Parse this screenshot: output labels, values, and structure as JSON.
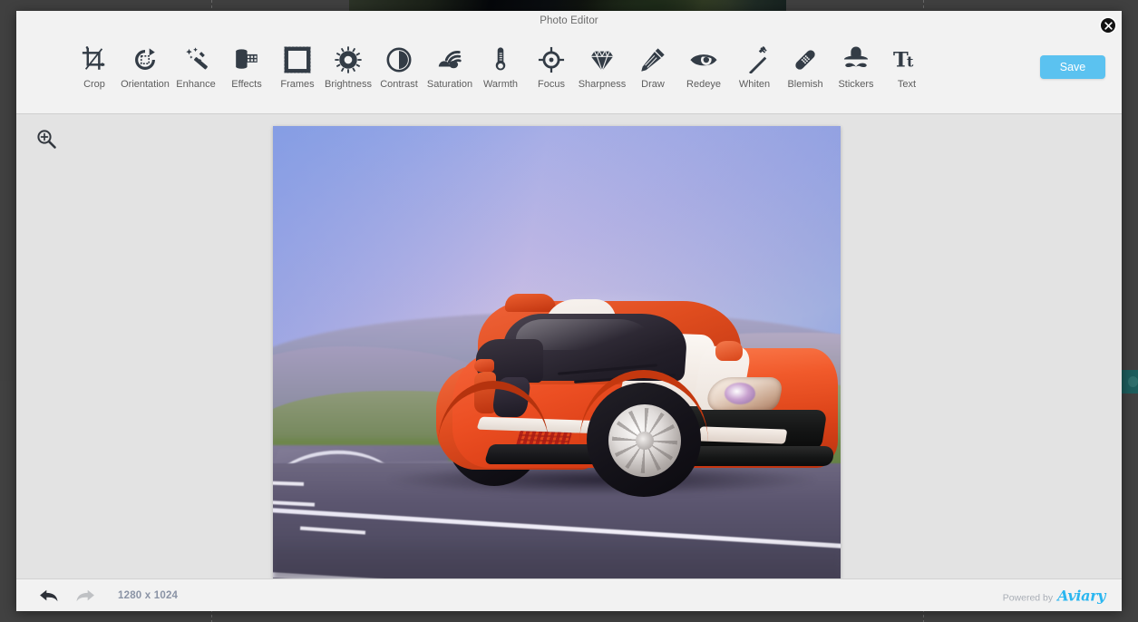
{
  "window": {
    "title": "Photo Editor",
    "close_icon": "close-icon",
    "save_label": "Save",
    "save_color": "#5bc2f0"
  },
  "toolbar": {
    "tools": [
      {
        "id": "crop",
        "label": "Crop",
        "icon": "crop-icon"
      },
      {
        "id": "orientation",
        "label": "Orientation",
        "icon": "rotate-icon"
      },
      {
        "id": "enhance",
        "label": "Enhance",
        "icon": "magic-wand-icon"
      },
      {
        "id": "effects",
        "label": "Effects",
        "icon": "film-roll-icon"
      },
      {
        "id": "frames",
        "label": "Frames",
        "icon": "frame-icon"
      },
      {
        "id": "brightness",
        "label": "Brightness",
        "icon": "sun-icon"
      },
      {
        "id": "contrast",
        "label": "Contrast",
        "icon": "contrast-circle-icon"
      },
      {
        "id": "saturation",
        "label": "Saturation",
        "icon": "saturation-drop-icon"
      },
      {
        "id": "warmth",
        "label": "Warmth",
        "icon": "thermometer-icon"
      },
      {
        "id": "focus",
        "label": "Focus",
        "icon": "focus-target-icon"
      },
      {
        "id": "sharpness",
        "label": "Sharpness",
        "icon": "diamond-icon"
      },
      {
        "id": "draw",
        "label": "Draw",
        "icon": "pencil-icon"
      },
      {
        "id": "redeye",
        "label": "Redeye",
        "icon": "eye-icon"
      },
      {
        "id": "whiten",
        "label": "Whiten",
        "icon": "toothbrush-icon"
      },
      {
        "id": "blemish",
        "label": "Blemish",
        "icon": "bandage-icon"
      },
      {
        "id": "stickers",
        "label": "Stickers",
        "icon": "hat-mustache-icon"
      },
      {
        "id": "text",
        "label": "Text",
        "icon": "text-tt-icon"
      }
    ]
  },
  "canvas": {
    "zoom_icon": "zoom-in-icon",
    "photo_alt": "orange ford gt sports car on mountain road"
  },
  "footer": {
    "undo_icon": "undo-arrow-icon",
    "redo_icon": "redo-arrow-icon",
    "dimensions": "1280 x 1024",
    "powered_by": "Powered by",
    "brand": "Aviary",
    "brand_color": "#2ab6f0"
  }
}
